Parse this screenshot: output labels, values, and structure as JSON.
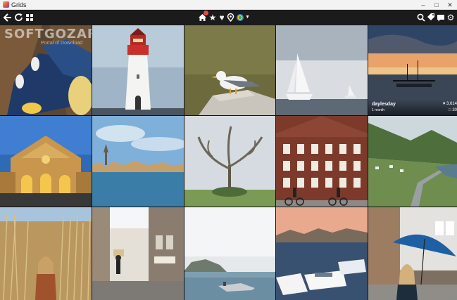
{
  "window": {
    "title": "Grids"
  },
  "toolbar": {
    "left_icons": [
      "back-arrow-icon",
      "refresh-icon",
      "grid-view-icon"
    ],
    "center_icons": [
      "home-icon",
      "star-icon",
      "heart-icon",
      "location-pin-icon",
      "profile-icon",
      "chevron-down-icon"
    ],
    "right_icons": [
      "search-icon",
      "tag-icon",
      "message-icon",
      "gear-icon"
    ]
  },
  "tiles": [
    {
      "subject": "feet-on-boardwalk"
    },
    {
      "subject": "lighthouse"
    },
    {
      "subject": "seagull-on-rock"
    },
    {
      "subject": "sailboat",
      "caption": null
    },
    {
      "subject": "sunset-harbor",
      "caption": {
        "user": "daylesday",
        "time": "1 month",
        "likes": "3,614",
        "comments": "30"
      }
    },
    {
      "subject": "church-facade"
    },
    {
      "subject": "city-waterfront"
    },
    {
      "subject": "tree-in-fog"
    },
    {
      "subject": "brick-building-cyclists"
    },
    {
      "subject": "fjord-road"
    },
    {
      "subject": "woman-in-reeds"
    },
    {
      "subject": "narrow-alley"
    },
    {
      "subject": "misty-lake"
    },
    {
      "subject": "boats-harbor"
    },
    {
      "subject": "woman-umbrella"
    }
  ],
  "watermark": {
    "text": "SOFTGOZAR.COM",
    "sub": "Portal of Download"
  },
  "colors": {
    "toolbar_bg": "#1b1b1b",
    "badge": "#e74c3c",
    "sky": "#8fb9e6",
    "sunset": "#e8a36a"
  }
}
